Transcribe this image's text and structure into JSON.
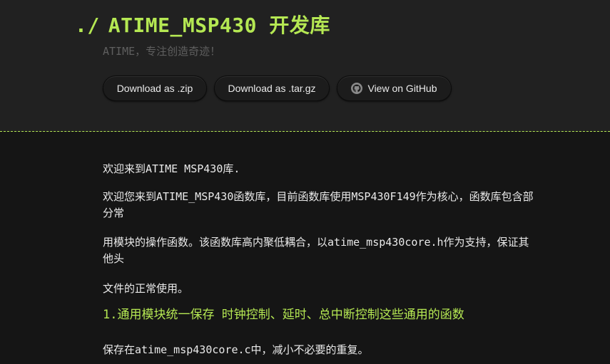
{
  "header": {
    "title_prefix": "./",
    "title": "ATIME_MSP430 开发库",
    "tagline": "ATIME，专注创造奇迹！"
  },
  "buttons": {
    "zip_label": "Download as .zip",
    "tar_label": "Download as .tar.gz",
    "github_label": "View on GitHub",
    "github_icon": "github-octocat-icon"
  },
  "content": {
    "p1": "欢迎来到ATIME MSP430库.",
    "p2": "欢迎您来到ATIME_MSP430函数库，目前函数库使用MSP430F149作为核心，函数库包含部分常",
    "p3": "用模块的操作函数。该函数库高内聚低耦合，以atime_msp430core.h作为支持，保证其他头",
    "p4": "文件的正常使用。",
    "heading": "1.通用模块统一保存 时钟控制、延时、总中断控制这些通用的函数",
    "p6": "保存在atime_msp430core.c中，减小不必要的重复。"
  },
  "colors": {
    "accent": "#b5e853",
    "background": "#151515",
    "header_background": "#212121",
    "text": "#eaeaea",
    "tagline": "#5f5f5f"
  }
}
